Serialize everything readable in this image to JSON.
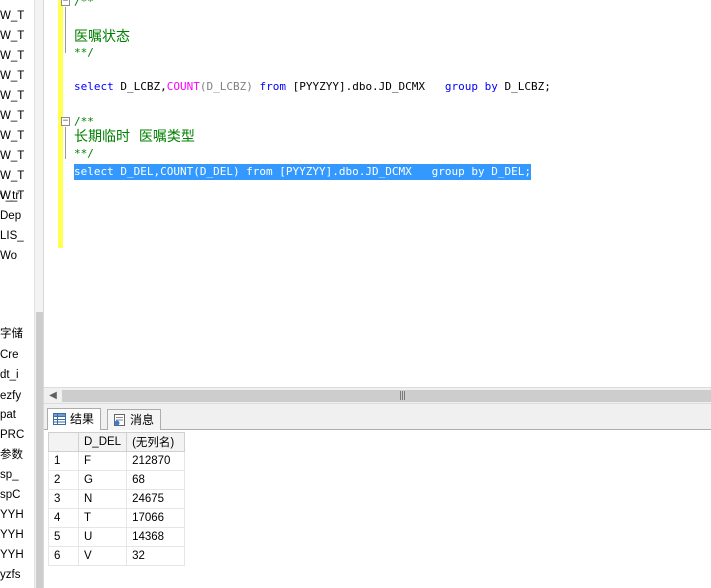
{
  "explorer": {
    "items": [
      "W_T",
      "W_T",
      "W_T",
      "W_T",
      "W_T",
      "W_T",
      "W_T",
      "W_T",
      "W_T",
      "W_T",
      "v_tr",
      "Dep",
      "LIS_",
      "Wo",
      "",
      "",
      "字储",
      "Cre",
      "dt_i",
      "ezfy",
      "pat",
      "PRC",
      "参数",
      "sp_",
      "spC",
      "YYH",
      "YYH",
      "YYH",
      "yzfs"
    ]
  },
  "editor": {
    "lines": {
      "c1_open": "/**",
      "c1_text": "医嘱状态",
      "c1_close": "**/",
      "q1_select": "select",
      "q1_cols": " D_LCBZ,",
      "q1_count": "COUNT",
      "q1_arg": "(D_LCBZ)",
      "q1_from": " from",
      "q1_table": " [PYYZYY].dbo.JD_DCMX",
      "q1_group": "   group by",
      "q1_tail": " D_LCBZ;",
      "c2_open": "/**",
      "c2_text": "长期临时  医嘱类型",
      "c2_close": "**/",
      "q2_text": "select D_DEL,COUNT(D_DEL) from [PYYZYY].dbo.JD_DCMX   group by D_DEL;"
    }
  },
  "results": {
    "tabs": [
      {
        "label": "结果",
        "icon": "grid-icon",
        "active": true
      },
      {
        "label": "消息",
        "icon": "message-icon",
        "active": false
      }
    ],
    "columns": [
      "D_DEL",
      "(无列名)"
    ],
    "rows": [
      {
        "num": "1",
        "c1": "F",
        "c2": "212870"
      },
      {
        "num": "2",
        "c1": "G",
        "c2": "68"
      },
      {
        "num": "3",
        "c1": "N",
        "c2": "24675"
      },
      {
        "num": "4",
        "c1": "T",
        "c2": "17066"
      },
      {
        "num": "5",
        "c1": "U",
        "c2": "14368"
      },
      {
        "num": "6",
        "c1": "V",
        "c2": "32"
      }
    ]
  }
}
